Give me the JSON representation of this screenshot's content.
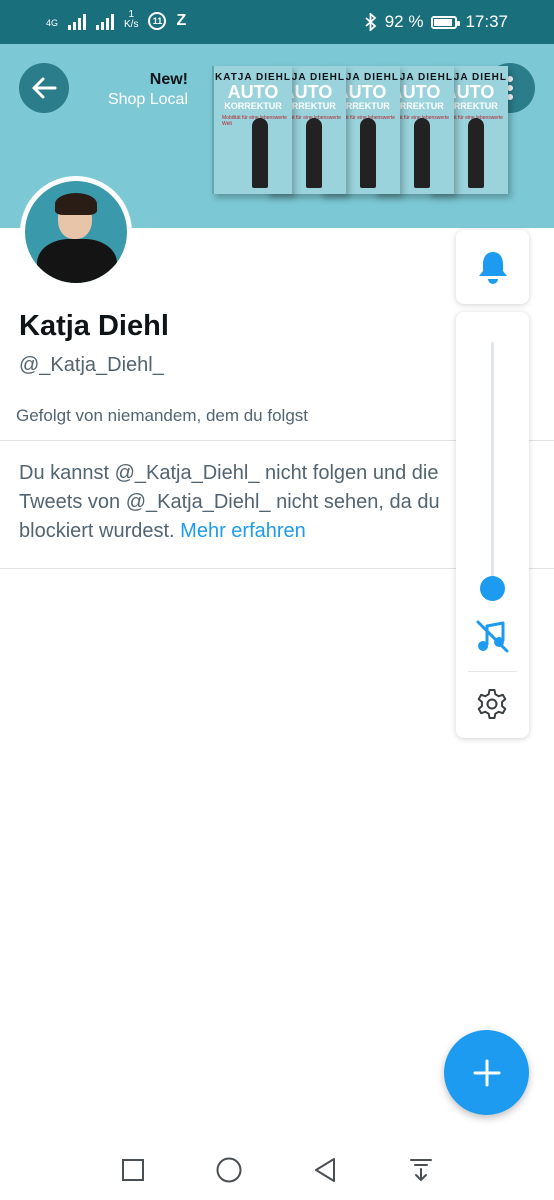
{
  "status_bar": {
    "network": "4G",
    "speed_value": "1",
    "speed_unit": "K/s",
    "badge_a": "11",
    "badge_b": "Z",
    "battery_text": "92 %",
    "battery_level": 0.92,
    "time": "17:37"
  },
  "banner": {
    "new_label": "New!",
    "shop_label": "Shop Local",
    "book_author": "KATJA DIEHL",
    "book_title_1": "AUTO",
    "book_title_2": "KORREKTUR",
    "book_subtitle": "Mobilität für eine lebenswerte Welt",
    "book_count": 5,
    "background_color": "#7cc8d4"
  },
  "profile": {
    "name": "Katja Diehl",
    "handle": "@_Katja_Diehl_",
    "followed_by": "Gefolgt von niemandem, dem du folgst"
  },
  "blocked_notice": {
    "text": "Du kannst @_Katja_Diehl_ nicht folgen und die Tweets von @_Katja_Diehl_ nicht sehen, da du blockiert wurdest. ",
    "link": "Mehr erfahren"
  },
  "volume_panel": {
    "level": 0.0,
    "mode_icon": "music-off-icon",
    "accent_color": "#1d9bf0"
  },
  "colors": {
    "accent": "#1d9bf0",
    "status_bar": "#1a6f7d",
    "secondary_text": "#536471"
  },
  "icons": {
    "back": "arrow-left-icon",
    "more": "more-vertical-icon",
    "bell": "bell-icon",
    "settings": "gear-icon",
    "compose": "plus-icon",
    "nav_recents": "square-icon",
    "nav_home": "circle-icon",
    "nav_back": "triangle-back-icon",
    "nav_notifications": "pull-down-icon"
  }
}
